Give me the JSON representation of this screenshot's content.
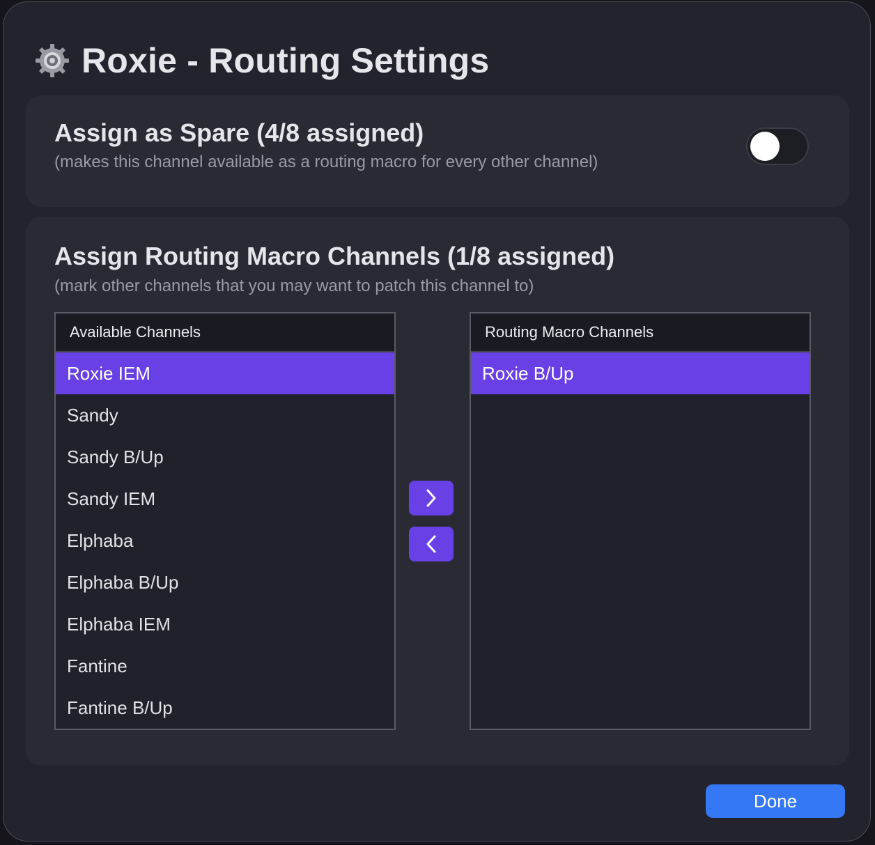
{
  "window": {
    "title": "Roxie - Routing Settings",
    "title_icon": "gear-icon"
  },
  "spare": {
    "heading": "Assign as Spare (4/8 assigned)",
    "description": "(makes this channel available as a routing macro for every other channel)",
    "toggle_on": false
  },
  "macro": {
    "heading": "Assign Routing Macro Channels (1/8 assigned)",
    "description": "(mark other channels that you may want to patch this channel to)",
    "available": {
      "header": "Available Channels",
      "items": [
        {
          "label": "Roxie IEM",
          "selected": true
        },
        {
          "label": "Sandy",
          "selected": false
        },
        {
          "label": "Sandy B/Up",
          "selected": false
        },
        {
          "label": "Sandy IEM",
          "selected": false
        },
        {
          "label": "Elphaba",
          "selected": false
        },
        {
          "label": "Elphaba B/Up",
          "selected": false
        },
        {
          "label": "Elphaba IEM",
          "selected": false
        },
        {
          "label": "Fantine",
          "selected": false
        },
        {
          "label": "Fantine B/Up",
          "selected": false
        }
      ]
    },
    "routing": {
      "header": "Routing Macro Channels",
      "items": [
        {
          "label": "Roxie B/Up",
          "selected": true
        }
      ]
    },
    "add_icon": "chevron-right-icon",
    "remove_icon": "chevron-left-icon"
  },
  "footer": {
    "done_label": "Done"
  },
  "colors": {
    "accent_purple": "#6840e6",
    "done_blue": "#3478f6",
    "window_bg": "#23232d",
    "card_bg": "#2a2a35"
  }
}
